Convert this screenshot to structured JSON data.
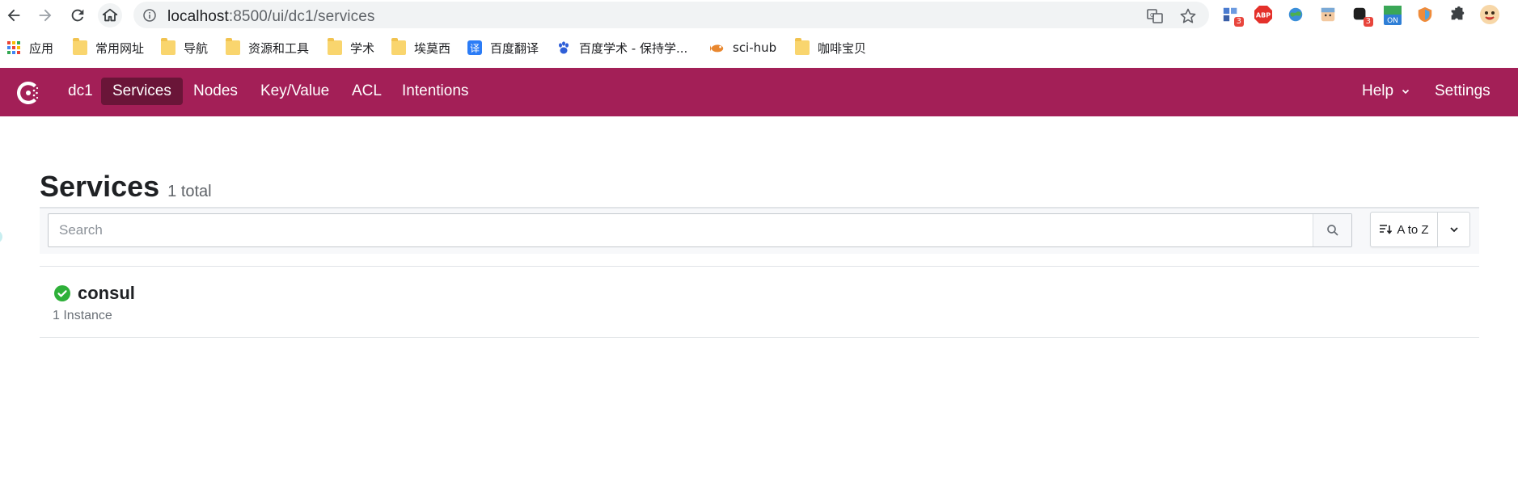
{
  "browser": {
    "url_host": "localhost",
    "url_path": ":8500/ui/dc1/services",
    "extension_badges": [
      "3",
      "3"
    ],
    "extension_on_label": "ON",
    "abp_label": "ABP"
  },
  "bookmarks": [
    {
      "label": "应用",
      "icon": "apps-grid-icon"
    },
    {
      "label": "常用网址",
      "icon": "folder-icon"
    },
    {
      "label": "导航",
      "icon": "folder-icon"
    },
    {
      "label": "资源和工具",
      "icon": "folder-icon"
    },
    {
      "label": "学术",
      "icon": "folder-icon"
    },
    {
      "label": "埃莫西",
      "icon": "folder-icon"
    },
    {
      "label": "百度翻译",
      "icon": "translate-icon"
    },
    {
      "label": "百度学术 - 保持学...",
      "icon": "baidu-paw-icon"
    },
    {
      "label": "sci-hub",
      "icon": "scihub-icon"
    },
    {
      "label": "咖啡宝贝",
      "icon": "folder-icon"
    }
  ],
  "nav": {
    "datacenter": "dc1",
    "items": [
      "Services",
      "Nodes",
      "Key/Value",
      "ACL",
      "Intentions"
    ],
    "active": "Services",
    "help": "Help",
    "settings": "Settings"
  },
  "page": {
    "title": "Services",
    "count": "1 total"
  },
  "filter": {
    "search_placeholder": "Search",
    "search_value": "",
    "sort_label": "A to Z"
  },
  "services": [
    {
      "name": "consul",
      "meta": "1 Instance",
      "status": "passing"
    }
  ],
  "colors": {
    "brand": "#a31f57",
    "brand_active": "#6a1538",
    "passing": "#2eb039"
  }
}
